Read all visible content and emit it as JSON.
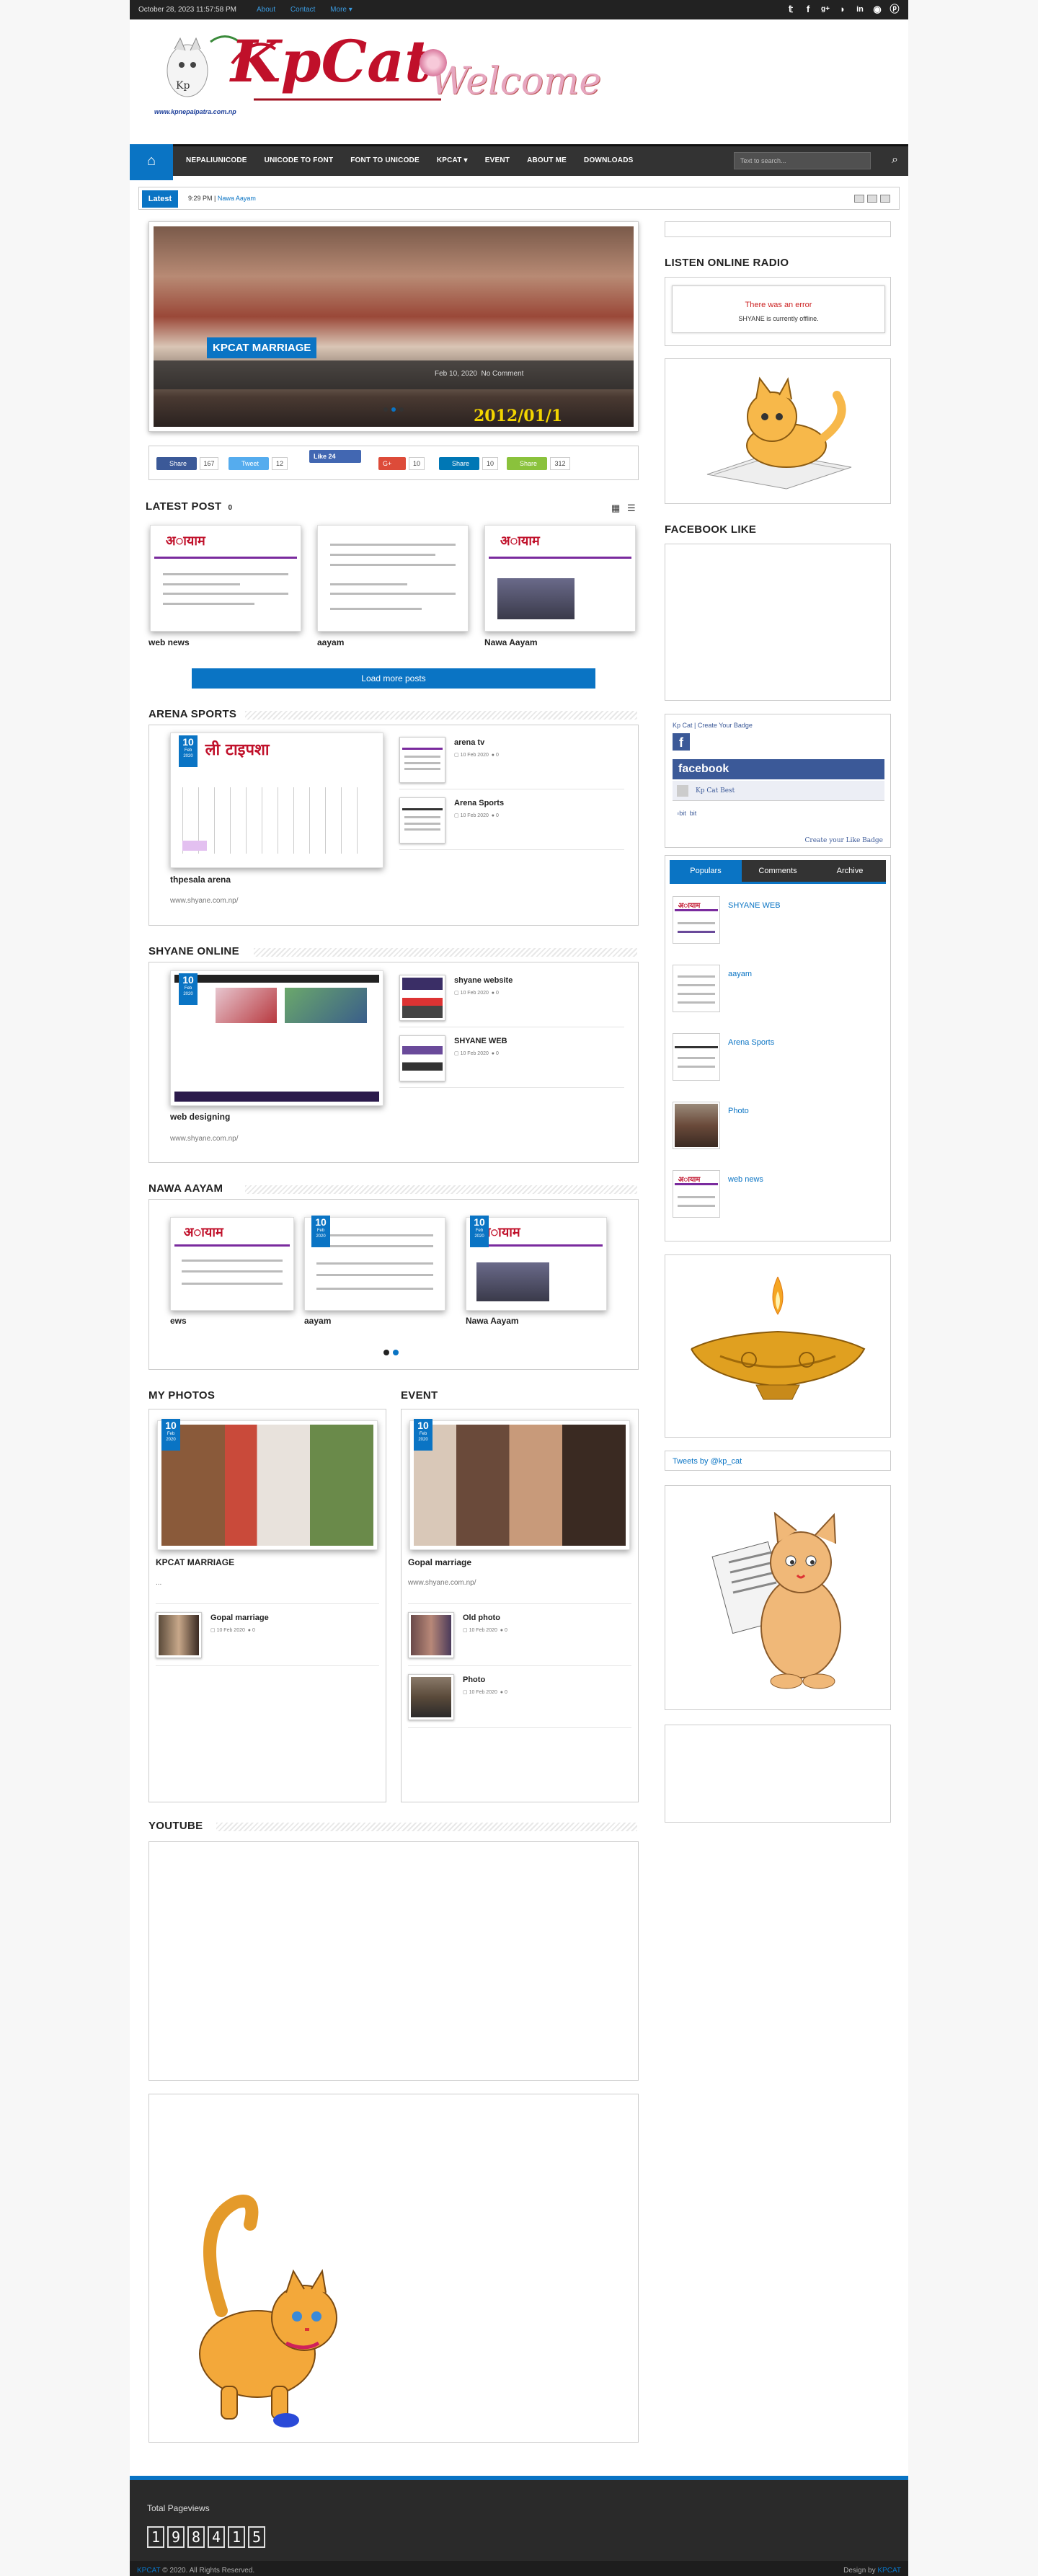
{
  "topbar": {
    "date": "October 28, 2023 11:57:58 PM",
    "links": [
      "About",
      "Contact",
      "More"
    ]
  },
  "header": {
    "logo_text": "KpCat",
    "site_url": "www.kpnepalpatra.com.np",
    "welcome": "Welcome"
  },
  "nav": {
    "items": [
      "NEPALIUNICODE",
      "UNICODE TO FONT",
      "FONT TO UNICODE",
      "KPCAT",
      "EVENT",
      "ABOUT ME",
      "DOWNLOADS"
    ],
    "search_placeholder": "Text to search..."
  },
  "ticker": {
    "label": "Latest",
    "time": "9:29 PM |",
    "headline": "Nawa Aayam"
  },
  "slider": {
    "title": "KPCAT MARRIAGE",
    "date": "Feb 10, 2020",
    "comments": "No Comment",
    "overlay_year": "2012/01/1"
  },
  "share": [
    {
      "label": "Share",
      "count": "167"
    },
    {
      "label": "Tweet",
      "count": "12"
    },
    {
      "label": "Like 24",
      "count": ""
    },
    {
      "label": "G+",
      "count": "10"
    },
    {
      "label": "Share",
      "count": "10"
    },
    {
      "label": "Share",
      "count": "312"
    }
  ],
  "latest_post": {
    "title": "LATEST POST",
    "count": "0",
    "items": [
      "web news",
      "aayam",
      "Nawa Aayam"
    ],
    "load_more": "Load more posts"
  },
  "arena": {
    "title": "ARENA SPORTS",
    "main": {
      "day": "10",
      "month": "Feb",
      "year": "2020",
      "title": "thpesala arena",
      "sub": "www.shyane.com.np/"
    },
    "side": [
      {
        "title": "arena tv",
        "date": "10 Feb 2020",
        "count": "0"
      },
      {
        "title": "Arena Sports",
        "date": "10 Feb 2020",
        "count": "0"
      }
    ]
  },
  "shyane": {
    "title": "SHYANE ONLINE",
    "main": {
      "day": "10",
      "month": "Feb",
      "year": "2020",
      "title": "web designing",
      "sub": "www.shyane.com.np/"
    },
    "side": [
      {
        "title": "shyane website",
        "date": "10 Feb 2020",
        "count": "0"
      },
      {
        "title": "SHYANE WEB",
        "date": "10 Feb 2020",
        "count": "0"
      }
    ]
  },
  "nawa": {
    "title": "NAWA AAYAM",
    "items": [
      {
        "title": "ews"
      },
      {
        "title": "aayam",
        "day": "10",
        "month": "Feb",
        "year": "2020"
      },
      {
        "title": "Nawa Aayam",
        "day": "10",
        "month": "Feb",
        "year": "2020"
      }
    ]
  },
  "photos": {
    "title": "MY PHOTOS",
    "main": {
      "day": "10",
      "month": "Feb",
      "year": "2020",
      "title": "KPCAT MARRIAGE",
      "sub": "..."
    },
    "side": [
      {
        "title": "Gopal marriage",
        "date": "10 Feb 2020",
        "count": "0"
      }
    ]
  },
  "event": {
    "title": "EVENT",
    "main": {
      "day": "10",
      "month": "Feb",
      "year": "2020",
      "title": "Gopal marriage",
      "sub": "www.shyane.com.np/"
    },
    "side": [
      {
        "title": "Old photo",
        "date": "10 Feb 2020",
        "count": "0"
      },
      {
        "title": "Photo",
        "date": "10 Feb 2020",
        "count": "0"
      }
    ]
  },
  "youtube": {
    "title": "YOUTUBE"
  },
  "sidebar": {
    "radio_title": "LISTEN ONLINE RADIO",
    "radio_error": "There was an error",
    "radio_status": "SHYANE is currently offline.",
    "fb_title": "FACEBOOK LIKE",
    "badge": {
      "link1": "Kp Cat",
      "sep": " | ",
      "link2": "Create Your Badge",
      "brand": "facebook",
      "name": "Kp Cat Best",
      "img_alt": "bit",
      "footer": "Create your Like Badge"
    },
    "tabs": [
      "Populars",
      "Comments",
      "Archive"
    ],
    "populars": [
      "SHYANE WEB",
      "aayam",
      "Arena Sports",
      "Photo",
      "web news"
    ],
    "tweets": "Tweets by @kp_cat"
  },
  "footer": {
    "pageviews_label": "Total Pageviews",
    "digits": [
      "1",
      "9",
      "8",
      "4",
      "1",
      "5"
    ],
    "brand": "KPCAT",
    "copyright": " © 2020. All Rights Reserved.",
    "design_by": "Design by ",
    "designer": "KPCAT"
  },
  "colors": {
    "accent": "#0a74c4",
    "dark": "#333333",
    "logo_red": "#c0102a"
  }
}
